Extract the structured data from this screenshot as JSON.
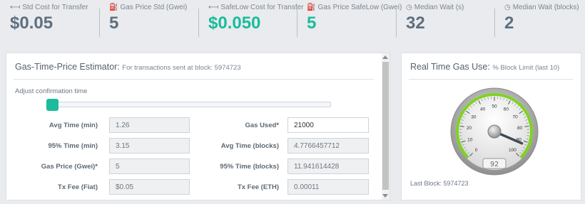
{
  "stats": [
    {
      "label": "Std Cost for Transfer",
      "value": "$0.05",
      "icon": "transfer-icon",
      "green": false
    },
    {
      "label": "Gas Price Std (Gwei)",
      "value": "5",
      "icon": "gas-pump-icon",
      "green": false
    },
    {
      "label": "SafeLow Cost for Transfer",
      "value": "$0.050",
      "icon": "transfer-icon",
      "green": true
    },
    {
      "label": "Gas Price SafeLow (Gwei)",
      "value": "5",
      "icon": "gas-pump-icon",
      "green": true
    },
    {
      "label": "Median Wait (s)",
      "value": "32",
      "icon": "clock-icon",
      "green": false
    },
    {
      "label": "Median Wait (blocks)",
      "value": "2",
      "icon": "clock-icon",
      "green": false
    }
  ],
  "estimator": {
    "title": "Gas-Time-Price Estimator:",
    "subtitle": "For transactions sent at block: 5974723",
    "adjust_label": "Adjust confirmation time",
    "slider_value": 0.0,
    "fields_left": [
      {
        "label": "Avg Time (min)",
        "value": "1.26",
        "editable": false
      },
      {
        "label": "95% Time (min)",
        "value": "3.15",
        "editable": false
      },
      {
        "label": "Gas Price (Gwei)*",
        "value": "5",
        "editable": true
      },
      {
        "label": "Tx Fee (Fiat)",
        "value": "$0.05",
        "editable": false
      }
    ],
    "fields_right": [
      {
        "label": "Gas Used*",
        "value": "21000",
        "editable": true
      },
      {
        "label": "Avg Time (blocks)",
        "value": "4.7766457712",
        "editable": false
      },
      {
        "label": "95% Time (blocks)",
        "value": "11.941614428",
        "editable": false
      },
      {
        "label": "Tx Fee (ETH)",
        "value": "0.00011",
        "editable": false
      }
    ]
  },
  "gas_use": {
    "title": "Real Time Gas Use:",
    "subtitle": "% Block Limit (last 10)",
    "gauge_value": 92,
    "gauge_display": "92",
    "tick_labels": [
      "0",
      "10",
      "20",
      "30",
      "40",
      "50",
      "60",
      "70",
      "80",
      "90",
      "100"
    ],
    "last_block": "Last Block: 5974723",
    "arc_color": "#7ed321"
  }
}
